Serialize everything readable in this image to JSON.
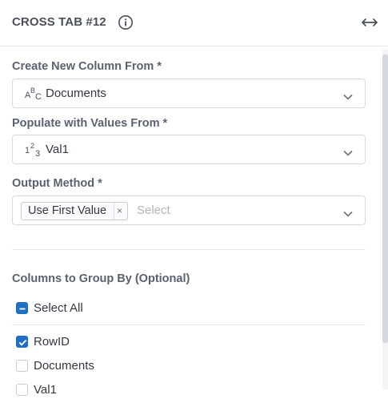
{
  "header": {
    "title": "CROSS TAB #12",
    "info_icon": "info-icon",
    "expand_icon": "expand-horizontal-icon"
  },
  "fields": {
    "new_column": {
      "label": "Create New Column From *",
      "type_icon": "string-type-icon",
      "type_glyph": "AᴮC",
      "value": "Documents"
    },
    "populate": {
      "label": "Populate with Values From *",
      "type_icon": "number-type-icon",
      "type_glyph": "1²₃",
      "value": "Val1"
    },
    "output_method": {
      "label": "Output Method *",
      "chip": "Use First Value",
      "chip_remove": "×",
      "placeholder": "Select"
    }
  },
  "group_by": {
    "title": "Columns to Group By (Optional)",
    "select_all": {
      "label": "Select All",
      "state": "indeterminate"
    },
    "items": [
      {
        "label": "RowID",
        "checked": true
      },
      {
        "label": "Documents",
        "checked": false
      },
      {
        "label": "Val1",
        "checked": false
      }
    ]
  },
  "colors": {
    "accent": "#1f6fc5",
    "border": "#d7dae0",
    "label": "#5a6170"
  }
}
